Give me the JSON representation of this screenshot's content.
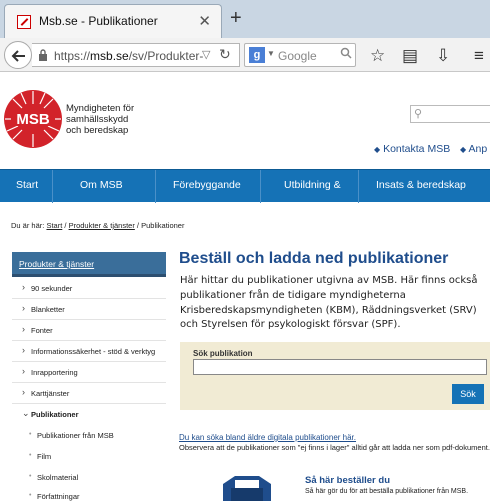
{
  "browser": {
    "tab_title": "Msb.se - Publikationer",
    "url_host": "msb.se",
    "url_prefix": "https://",
    "url_path": "/sv/Produkter-",
    "search_placeholder": "Google"
  },
  "site": {
    "org_name_line1": "Myndigheten för",
    "org_name_line2": "samhällsskydd",
    "org_name_line3": "och beredskap",
    "logo_text": "MSB",
    "top_links": [
      "Kontakta MSB",
      "Anp"
    ],
    "nav": [
      "Start",
      "Om MSB",
      "Förebyggande",
      "Utbildning &",
      "Insats & beredskap"
    ]
  },
  "breadcrumb": {
    "prefix": "Du är här:",
    "items": [
      "Start",
      "Produkter & tjänster"
    ],
    "current": "Publikationer"
  },
  "sidebar": {
    "heading": "Produkter & tjänster",
    "items": [
      "90 sekunder",
      "Blanketter",
      "Fonter",
      "Informationssäkerhet - stöd & verktyg",
      "Inrapportering",
      "Karttjänster",
      "Publikationer"
    ],
    "subitems": [
      "Publikationer från MSB",
      "Film",
      "Skolmaterial",
      "Författningar"
    ]
  },
  "main": {
    "title": "Beställ och ladda ned publikationer",
    "intro": "Här hittar du publikationer utgivna av MSB. Här finns också publikationer från de tidigare myndigheterna Krisberedskapsmyndigheten (KBM), Räddningsverket (SRV) och Styrelsen för psykologiskt försvar (SPF).",
    "search_label": "Sök publikation",
    "search_button": "Sök",
    "older_link": "Du kan söka bland äldre digitala publikationer här.",
    "note": "Observera att de publikationer som \"ej finns i lager\" alltid går att ladda ner som pdf-dokument.",
    "howto_title": "Så här beställer du",
    "howto_text": "Så här gör du för att beställa publikationer från MSB."
  },
  "colors": {
    "brand_red": "#d2232a",
    "nav_blue": "#1572b6",
    "link_blue": "#1f4d8c",
    "search_panel": "#f1ebd4"
  }
}
